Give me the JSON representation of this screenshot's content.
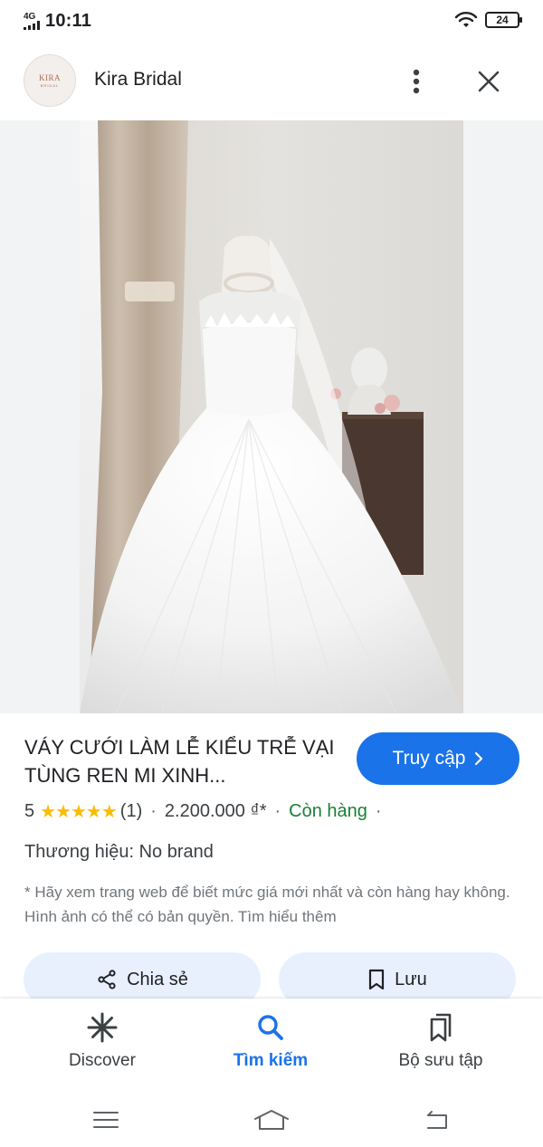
{
  "status_bar": {
    "network": "4G",
    "time": "10:11",
    "battery": "24"
  },
  "header": {
    "logo_text": "KIRA",
    "logo_subtext": "BRIDAL",
    "site_name": "Kira Bridal",
    "more_icon": "more-vert-icon",
    "close_icon": "close-icon"
  },
  "product": {
    "image_alt": "wedding-dress-photo",
    "title": "VÁY CƯỚI LÀM LỄ KIỂU TRỄ VẠI TÙNG REN MI XINH...",
    "visit_label": "Truy cập",
    "rating": "5",
    "stars": "★★★★★",
    "rating_count": "(1)",
    "price": "2.200.000 ₫*",
    "stock": "Còn hàng",
    "brand": "Thương hiệu: No brand",
    "disclaimer": "* Hãy xem trang web để biết mức giá mới nhất và còn hàng hay không. Hình ảnh có thể có bản quyền. Tìm hiểu thêm"
  },
  "actions": {
    "share_label": "Chia sẻ",
    "save_label": "Lưu"
  },
  "bottom_nav": {
    "items": [
      {
        "label": "Discover",
        "icon": "asterisk-icon"
      },
      {
        "label": "Tìm kiếm",
        "icon": "search-icon",
        "active": true
      },
      {
        "label": "Bộ sưu tập",
        "icon": "collections-icon"
      }
    ]
  },
  "colors": {
    "accent": "#1a73e8",
    "stock": "#188038",
    "star": "#fbbc04",
    "button_bg": "#e8f0fe"
  }
}
